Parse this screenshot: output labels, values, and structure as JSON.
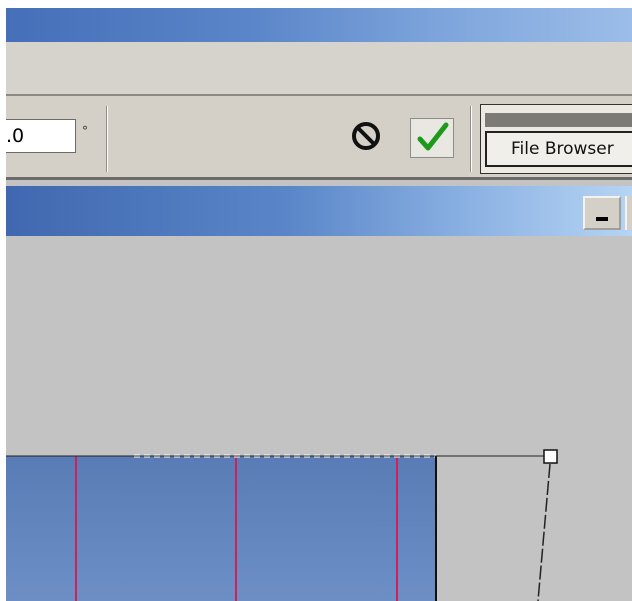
{
  "options_bar": {
    "angle_value": ".0",
    "degree_symbol": "°",
    "cancel_icon": "cancel-transform-icon",
    "commit_icon": "commit-checkmark-icon"
  },
  "palette_well": {
    "tab_label": "File Browser"
  },
  "document_window": {
    "minimize_icon": "minimize-icon"
  },
  "colors": {
    "titlebar": "#5b86c9",
    "chrome": "#d4d0c8",
    "canvas_bg": "#c3c3c3",
    "selection_fill": "#5f81bb",
    "guide_lines": "#d0205a",
    "checkmark": "#1b9a1b"
  }
}
